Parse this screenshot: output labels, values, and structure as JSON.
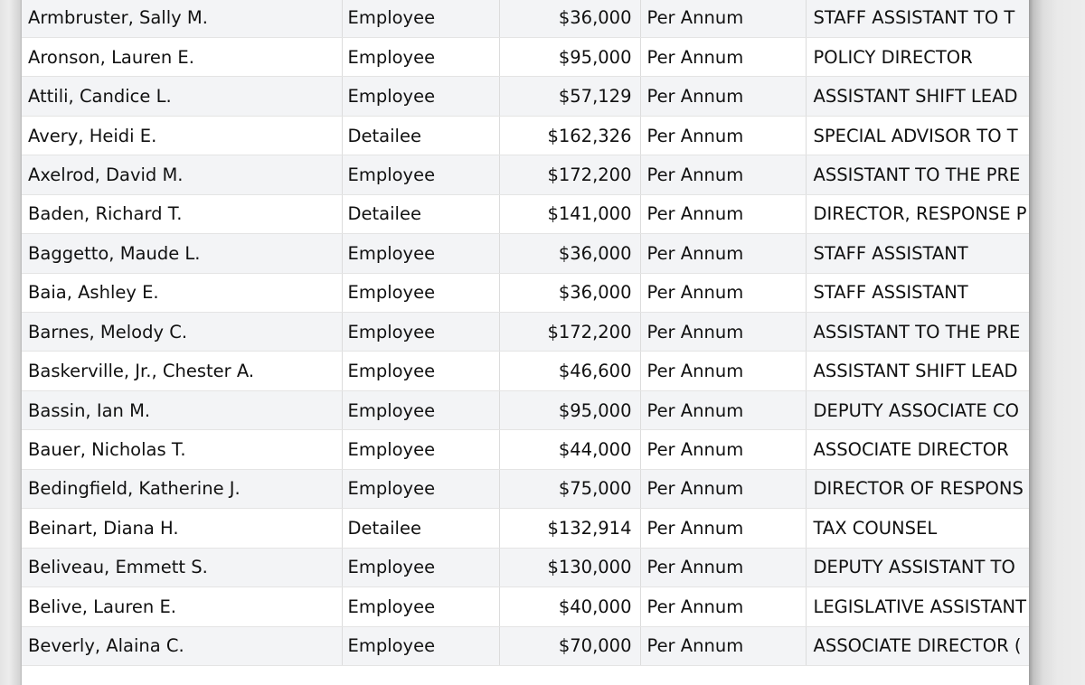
{
  "table": {
    "rows": [
      {
        "name": "Armbruster, Sally M.",
        "type": "Employee",
        "salary": "$36,000",
        "basis": "Per Annum",
        "title": "STAFF ASSISTANT TO T"
      },
      {
        "name": "Aronson, Lauren E.",
        "type": "Employee",
        "salary": "$95,000",
        "basis": "Per Annum",
        "title": "POLICY DIRECTOR"
      },
      {
        "name": "Attili, Candice L.",
        "type": "Employee",
        "salary": "$57,129",
        "basis": "Per Annum",
        "title": "ASSISTANT SHIFT LEAD"
      },
      {
        "name": "Avery, Heidi E.",
        "type": "Detailee",
        "salary": "$162,326",
        "basis": "Per Annum",
        "title": "SPECIAL ADVISOR TO T"
      },
      {
        "name": "Axelrod, David M.",
        "type": "Employee",
        "salary": "$172,200",
        "basis": "Per Annum",
        "title": "ASSISTANT TO THE PRE"
      },
      {
        "name": "Baden, Richard T.",
        "type": "Detailee",
        "salary": "$141,000",
        "basis": "Per Annum",
        "title": "DIRECTOR, RESPONSE P"
      },
      {
        "name": "Baggetto, Maude L.",
        "type": "Employee",
        "salary": "$36,000",
        "basis": "Per Annum",
        "title": "STAFF ASSISTANT"
      },
      {
        "name": "Baia, Ashley E.",
        "type": "Employee",
        "salary": "$36,000",
        "basis": "Per Annum",
        "title": "STAFF ASSISTANT"
      },
      {
        "name": "Barnes, Melody C.",
        "type": "Employee",
        "salary": "$172,200",
        "basis": "Per Annum",
        "title": "ASSISTANT TO THE PRE"
      },
      {
        "name": "Baskerville, Jr., Chester A.",
        "type": "Employee",
        "salary": "$46,600",
        "basis": "Per Annum",
        "title": "ASSISTANT SHIFT LEAD"
      },
      {
        "name": "Bassin, Ian M.",
        "type": "Employee",
        "salary": "$95,000",
        "basis": "Per Annum",
        "title": "DEPUTY ASSOCIATE CO"
      },
      {
        "name": "Bauer, Nicholas T.",
        "type": "Employee",
        "salary": "$44,000",
        "basis": "Per Annum",
        "title": "ASSOCIATE DIRECTOR"
      },
      {
        "name": "Bedingfield, Katherine J.",
        "type": "Employee",
        "salary": "$75,000",
        "basis": "Per Annum",
        "title": "DIRECTOR OF RESPONS"
      },
      {
        "name": "Beinart, Diana H.",
        "type": "Detailee",
        "salary": "$132,914",
        "basis": "Per Annum",
        "title": "TAX COUNSEL"
      },
      {
        "name": "Beliveau, Emmett S.",
        "type": "Employee",
        "salary": "$130,000",
        "basis": "Per Annum",
        "title": "DEPUTY ASSISTANT TO"
      },
      {
        "name": "Belive, Lauren E.",
        "type": "Employee",
        "salary": "$40,000",
        "basis": "Per Annum",
        "title": "LEGISLATIVE ASSISTANT"
      },
      {
        "name": "Beverly, Alaina C.",
        "type": "Employee",
        "salary": "$70,000",
        "basis": "Per Annum",
        "title": "ASSOCIATE DIRECTOR ("
      }
    ]
  }
}
